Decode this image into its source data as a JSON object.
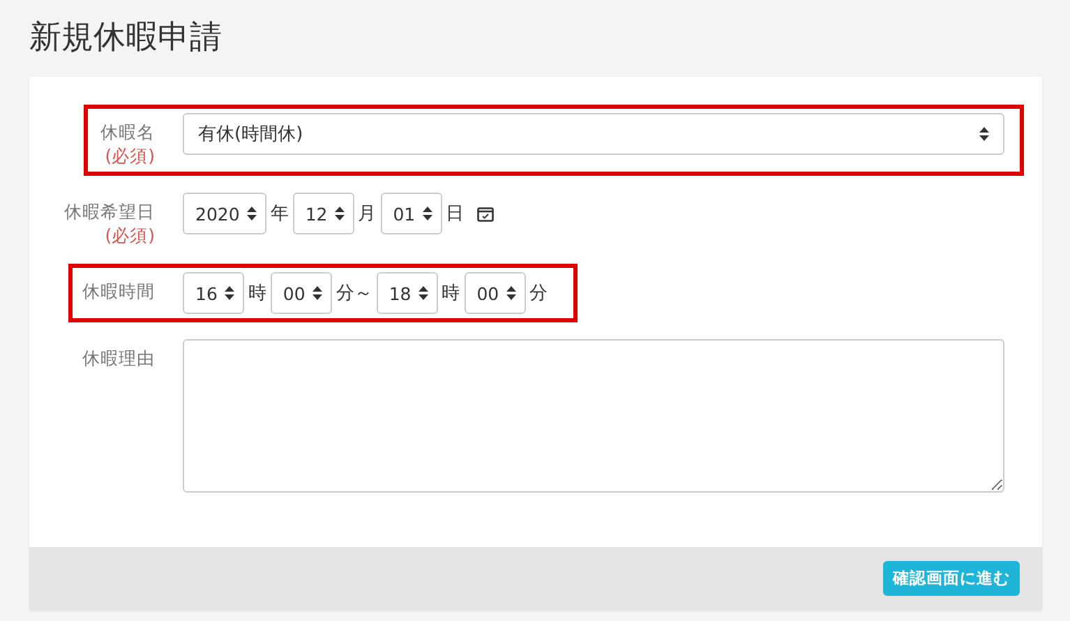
{
  "page_title": "新規休暇申請",
  "fields": [
    {
      "kind": "select",
      "label": "休暇名",
      "required": "(必須)",
      "highlighted": true,
      "value": "有休(時間休)"
    },
    {
      "kind": "inline",
      "label": "休暇希望日",
      "required": "(必須)",
      "highlighted": false,
      "parts": [
        {
          "kind": "spinner",
          "value": "2020"
        },
        {
          "kind": "unit",
          "text": "年"
        },
        {
          "kind": "spinner",
          "value": "12"
        },
        {
          "kind": "unit",
          "text": "月"
        },
        {
          "kind": "spinner",
          "value": "01"
        },
        {
          "kind": "unit",
          "text": "日"
        },
        {
          "kind": "calendar"
        }
      ]
    },
    {
      "kind": "inline",
      "label": "休暇時間",
      "highlighted": true,
      "parts": [
        {
          "kind": "spinner",
          "value": "16"
        },
        {
          "kind": "unit",
          "text": "時"
        },
        {
          "kind": "spinner",
          "value": "00"
        },
        {
          "kind": "unit",
          "text": "分～"
        },
        {
          "kind": "spinner",
          "value": "18"
        },
        {
          "kind": "unit",
          "text": "時"
        },
        {
          "kind": "spinner",
          "value": "00"
        },
        {
          "kind": "unit",
          "text": "分"
        }
      ]
    },
    {
      "kind": "textarea",
      "label": "休暇理由",
      "highlighted": false
    }
  ],
  "submit_button": "確認画面に進む"
}
